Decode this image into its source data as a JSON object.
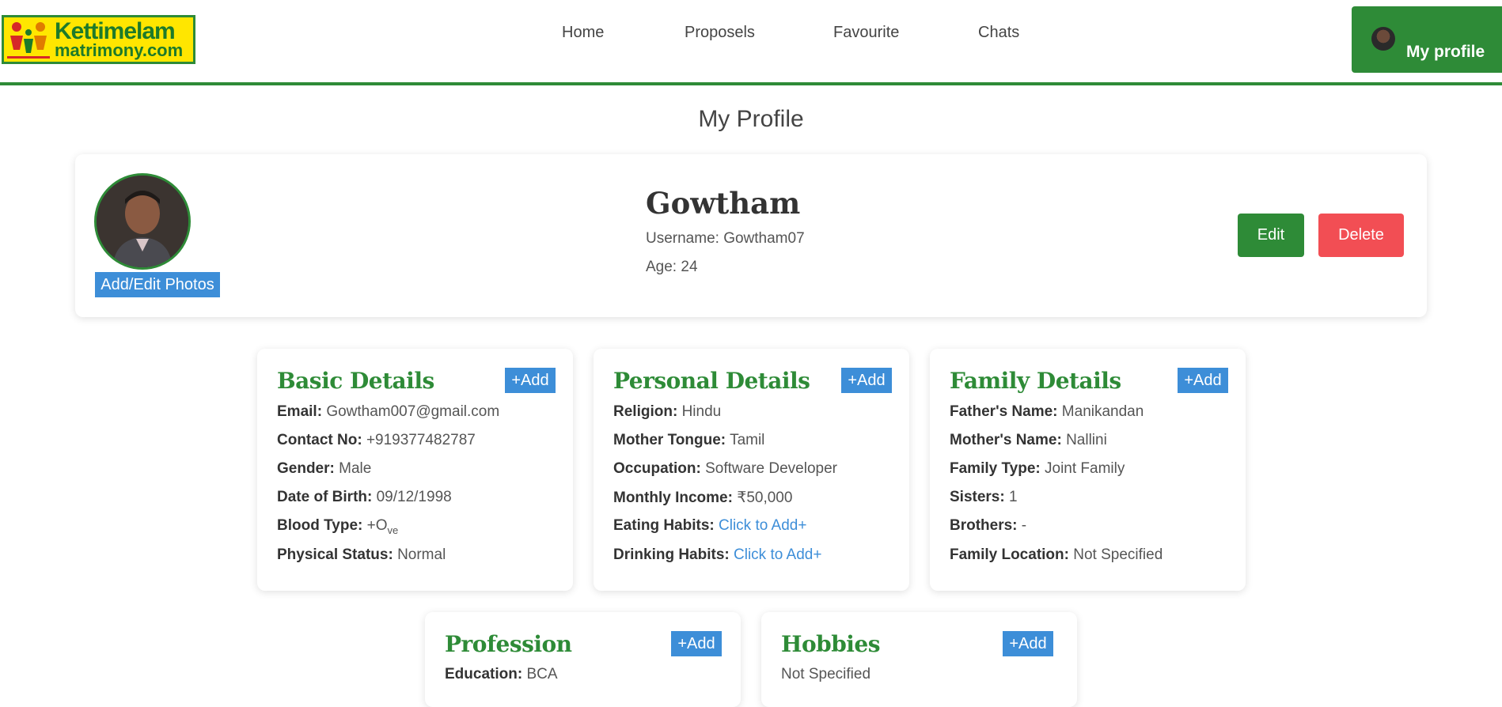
{
  "brand": {
    "line1": "Kettimelam",
    "line2": "matrimony.com"
  },
  "nav": {
    "home": "Home",
    "proposels": "Proposels",
    "favourite": "Favourite",
    "chats": "Chats"
  },
  "header": {
    "profile_button": "My profile"
  },
  "page": {
    "title": "My Profile"
  },
  "profile": {
    "name": "Gowtham",
    "username_label": "Username:",
    "username": "Gowtham07",
    "age_label": "Age:",
    "age": "24",
    "add_photos": "Add/Edit Photos",
    "edit": "Edit",
    "delete": "Delete"
  },
  "add_label": "+Add",
  "basic": {
    "title": "Basic Details",
    "rows": [
      {
        "label": "Email:",
        "value": "Gowtham007@gmail.com"
      },
      {
        "label": "Contact No:",
        "value": "+919377482787"
      },
      {
        "label": "Gender:",
        "value": "Male"
      },
      {
        "label": "Date of Birth:",
        "value": "09/12/1998"
      },
      {
        "label": "Blood Type:",
        "value": "+O",
        "sub": "ve"
      },
      {
        "label": "Physical Status:",
        "value": "Normal"
      }
    ]
  },
  "personal": {
    "title": "Personal Details",
    "rows": [
      {
        "label": "Religion:",
        "value": "Hindu"
      },
      {
        "label": "Mother Tongue:",
        "value": "Tamil"
      },
      {
        "label": "Occupation:",
        "value": "Software Developer"
      },
      {
        "label": "Monthly Income:",
        "value": "₹50,000"
      },
      {
        "label": "Eating Habits:",
        "value": "Click to Add+"
      },
      {
        "label": "Drinking Habits:",
        "value": "Click to Add+"
      }
    ]
  },
  "family": {
    "title": "Family Details",
    "rows": [
      {
        "label": "Father's Name:",
        "value": "Manikandan"
      },
      {
        "label": "Mother's Name:",
        "value": "Nallini"
      },
      {
        "label": "Family Type:",
        "value": "Joint Family"
      },
      {
        "label": "Sisters:",
        "value": "1"
      },
      {
        "label": "Brothers:",
        "value": "-"
      },
      {
        "label": "Family Location:",
        "value": "Not Specified"
      }
    ]
  },
  "profession": {
    "title": "Profession",
    "rows": [
      {
        "label": "Education:",
        "value": "BCA"
      }
    ]
  },
  "hobbies": {
    "title": "Hobbies",
    "value": "Not Specified"
  },
  "colors": {
    "green": "#2e8b37",
    "blue": "#3d8ed8",
    "red": "#f24e54"
  }
}
